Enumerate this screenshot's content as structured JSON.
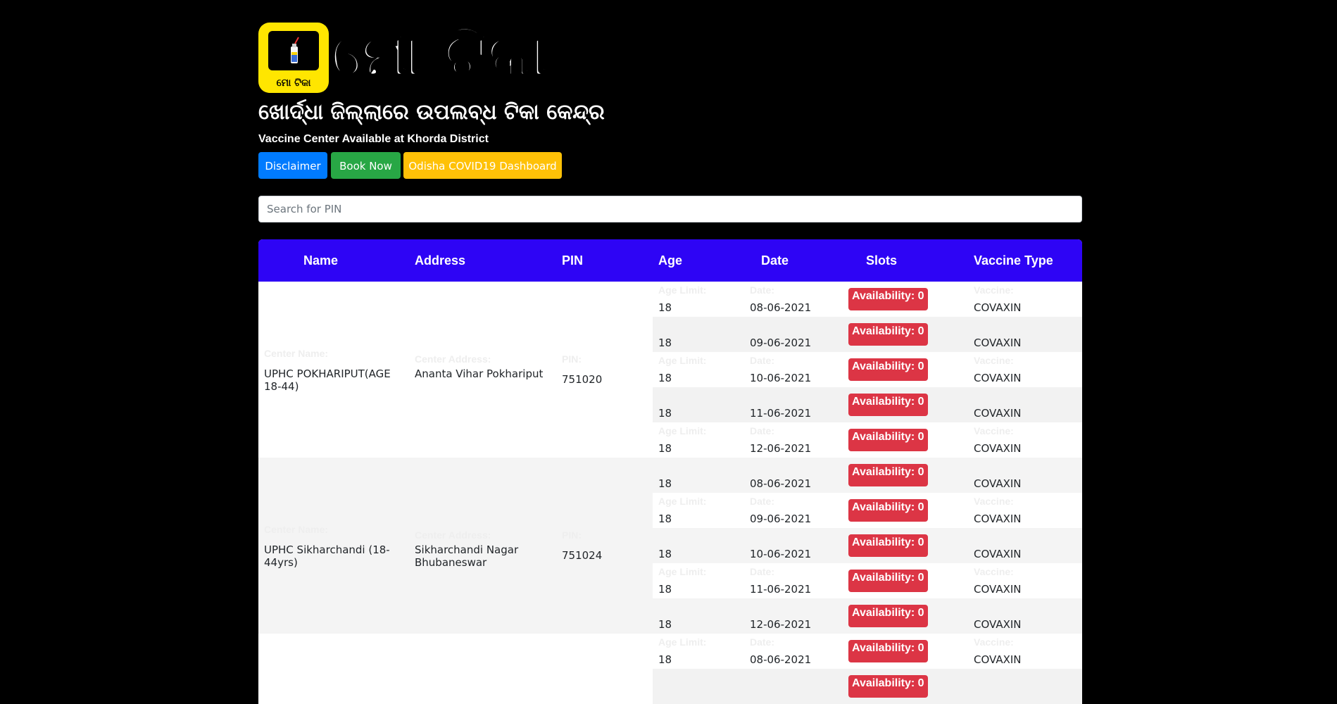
{
  "header": {
    "logo_text": "ମୋ ଟିକା",
    "title": "ମୋ ଟିକା",
    "subtitle_odia": "ଖୋର୍ଦ୍ଧା ଜିଲ୍ଲାରେ ଉପଲବ୍ଧ ଟିକା କେନ୍ଦ୍ର",
    "subtitle_en": "Vaccine Center Available at Khorda District"
  },
  "buttons": {
    "disclaimer": "Disclaimer",
    "book_now": "Book Now",
    "dashboard": "Odisha COVID19 Dashboard"
  },
  "search": {
    "placeholder": "Search for PIN",
    "value": ""
  },
  "table": {
    "headers": [
      "Name",
      "Address",
      "PIN",
      "Age",
      "Date",
      "Slots",
      "Vaccine Type"
    ],
    "labels": {
      "center_name": "Center Name:",
      "center_address": "Center Address:",
      "pin": "PIN:",
      "age_limit": "Age Limit:",
      "date": "Date:",
      "vaccine": "Vaccine:"
    },
    "centers": [
      {
        "name": "UPHC POKHARIPUT(AGE 18-44)",
        "address": "Ananta Vihar Pokhariput",
        "pin": "751020",
        "sessions": [
          {
            "age": "18",
            "date": "08-06-2021",
            "slots": "Availability: 0",
            "vaccine": "COVAXIN"
          },
          {
            "age": "18",
            "date": "09-06-2021",
            "slots": "Availability: 0",
            "vaccine": "COVAXIN"
          },
          {
            "age": "18",
            "date": "10-06-2021",
            "slots": "Availability: 0",
            "vaccine": "COVAXIN"
          },
          {
            "age": "18",
            "date": "11-06-2021",
            "slots": "Availability: 0",
            "vaccine": "COVAXIN"
          },
          {
            "age": "18",
            "date": "12-06-2021",
            "slots": "Availability: 0",
            "vaccine": "COVAXIN"
          }
        ]
      },
      {
        "name": "UPHC Sikharchandi (18-44yrs)",
        "address": "Sikharchandi Nagar Bhubaneswar",
        "pin": "751024",
        "sessions": [
          {
            "age": "18",
            "date": "08-06-2021",
            "slots": "Availability: 0",
            "vaccine": "COVAXIN"
          },
          {
            "age": "18",
            "date": "09-06-2021",
            "slots": "Availability: 0",
            "vaccine": "COVAXIN"
          },
          {
            "age": "18",
            "date": "10-06-2021",
            "slots": "Availability: 0",
            "vaccine": "COVAXIN"
          },
          {
            "age": "18",
            "date": "11-06-2021",
            "slots": "Availability: 0",
            "vaccine": "COVAXIN"
          },
          {
            "age": "18",
            "date": "12-06-2021",
            "slots": "Availability: 0",
            "vaccine": "COVAXIN"
          }
        ]
      },
      {
        "name": "",
        "address": "",
        "pin": "",
        "sessions": [
          {
            "age": "18",
            "date": "08-06-2021",
            "slots": "Availability: 0",
            "vaccine": "COVAXIN"
          },
          {
            "age": "",
            "date": "",
            "slots": "Availability: 0",
            "vaccine": ""
          }
        ]
      }
    ]
  },
  "colors": {
    "background": "#000000",
    "logo_bg": "#ffe600",
    "table_header": "#2e04f5",
    "badge": "#dc3545",
    "btn_blue": "#007bff",
    "btn_green": "#28a745",
    "btn_yellow": "#ffc107"
  },
  "icons": {
    "logo": "vaccine-vial-icon"
  }
}
